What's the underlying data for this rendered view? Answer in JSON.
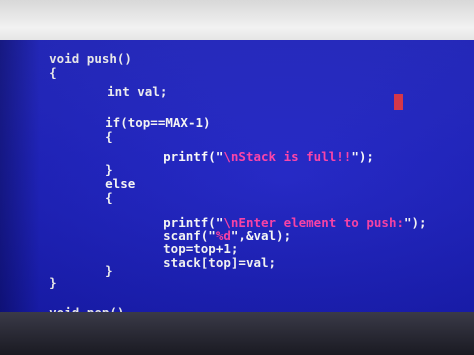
{
  "editor": {
    "lines": [
      {
        "id": "l1",
        "segments": [
          {
            "text": "void ",
            "color": "white"
          },
          {
            "text": "push()",
            "color": "white"
          }
        ]
      },
      {
        "id": "l2",
        "segments": [
          {
            "text": "{",
            "color": "white"
          }
        ]
      },
      {
        "id": "l3",
        "segments": [
          {
            "text": "int ",
            "color": "white"
          },
          {
            "text": "val;",
            "color": "white"
          }
        ]
      },
      {
        "id": "l4",
        "segments": [
          {
            "text": "if(top==MAX-1)",
            "color": "white"
          }
        ]
      },
      {
        "id": "l5",
        "segments": [
          {
            "text": "{",
            "color": "white"
          }
        ]
      },
      {
        "id": "l6",
        "segments": [
          {
            "text": "printf(\"",
            "color": "white"
          },
          {
            "text": "\\nStack is full!!",
            "color": "pink"
          },
          {
            "text": "\");",
            "color": "white"
          }
        ]
      },
      {
        "id": "l7",
        "segments": [
          {
            "text": "}",
            "color": "white"
          }
        ]
      },
      {
        "id": "l8",
        "segments": [
          {
            "text": "else",
            "color": "white"
          }
        ]
      },
      {
        "id": "l9",
        "segments": [
          {
            "text": "{",
            "color": "white"
          }
        ]
      },
      {
        "id": "l10",
        "segments": [
          {
            "text": "printf(\"",
            "color": "white"
          },
          {
            "text": "\\nEnter element to push:",
            "color": "pink"
          },
          {
            "text": "\");",
            "color": "white"
          }
        ]
      },
      {
        "id": "l11",
        "segments": [
          {
            "text": "scanf(\"",
            "color": "white"
          },
          {
            "text": "%d",
            "color": "pink"
          },
          {
            "text": "\",&val);",
            "color": "white"
          }
        ]
      },
      {
        "id": "l12",
        "segments": [
          {
            "text": "top=top+1;",
            "color": "white"
          }
        ]
      },
      {
        "id": "l13",
        "segments": [
          {
            "text": "stack[top]=val;",
            "color": "white"
          }
        ]
      },
      {
        "id": "l14",
        "segments": [
          {
            "text": "}",
            "color": "white"
          }
        ]
      },
      {
        "id": "l15",
        "segments": [
          {
            "text": "}",
            "color": "white"
          }
        ]
      },
      {
        "id": "l16",
        "segments": [
          {
            "text": "void ",
            "color": "white"
          },
          {
            "text": "pop()",
            "color": "white"
          }
        ]
      }
    ]
  },
  "colors": {
    "background": "#1e22c4",
    "text": "#ffffff",
    "string": "#ff3fa8",
    "margin_marker": "#6cff7a",
    "cursor": "#e2364a"
  }
}
